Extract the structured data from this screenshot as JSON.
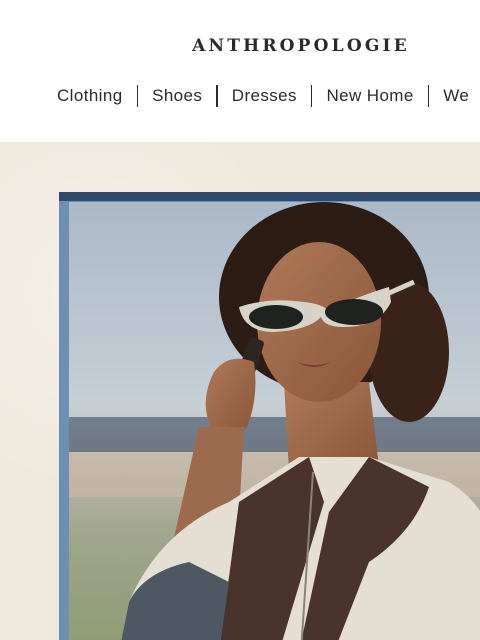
{
  "brand": {
    "name": "ANTHROPOLOGIE"
  },
  "nav": {
    "items": [
      {
        "label": "Clothing"
      },
      {
        "label": "Shoes"
      },
      {
        "label": "Dresses"
      },
      {
        "label": "New Home"
      },
      {
        "label": "We"
      }
    ]
  },
  "hero": {
    "image_icon": "model-photo",
    "colors": {
      "background": "#efe8dc",
      "frame": "#6e8fb1",
      "frame_top": "#2f4a6c"
    }
  }
}
